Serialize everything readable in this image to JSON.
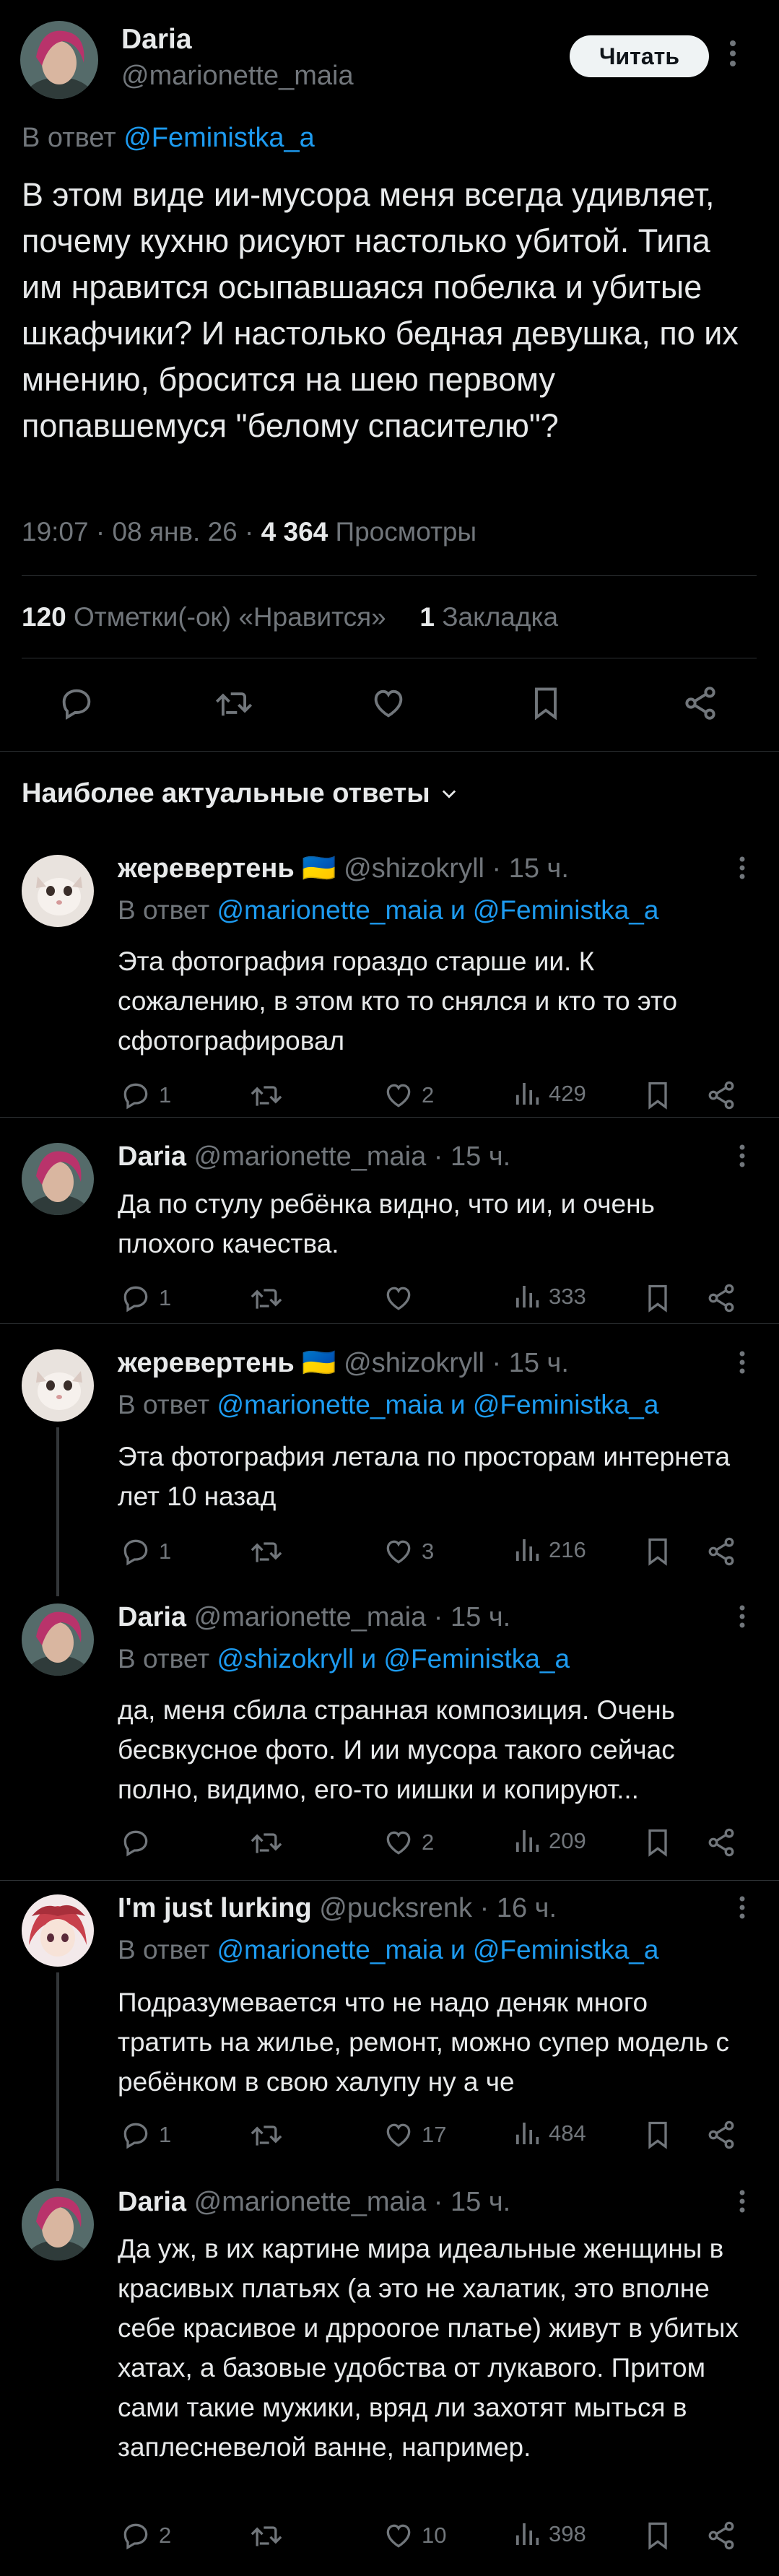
{
  "main": {
    "author_name": "Daria",
    "author_handle": "@marionette_maia",
    "follow_label": "Читать",
    "reply_prefix": "В ответ",
    "reply_to": "@Feministka_a",
    "text": "В этом виде ии-мусора меня всегда удивляет, почему кухню рисуют настолько убитой. Типа им нравится осыпавшаяся побелка и убитые шкафчики? И настолько бедная девушка, по их мнению, бросится на шею первому попавшемуся \"белому спасителю\"?",
    "time": "19:07 · 08 янв. 26 ·",
    "views_count": "4 364",
    "views_label": "Просмотры",
    "likes_count": "120",
    "likes_label": "Отметки(-ок) «Нравится»",
    "bookmarks_count": "1",
    "bookmarks_label": "Закладка"
  },
  "section_title": "Наиболее актуальные ответы",
  "replies": [
    {
      "name": "жеревертень 🇺🇦",
      "handle": "@shizokryll",
      "time": "· 15 ч.",
      "reply_prefix": "В ответ",
      "reply_to": "@marionette_maia и @Feministka_a",
      "text": "Эта фотография гораздо старше ии. К сожалению, в этом кто то снялся и кто то это сфотографировал",
      "replies": "1",
      "retweets": "",
      "likes": "2",
      "views": "429"
    },
    {
      "name": "Daria",
      "handle": "@marionette_maia",
      "time": "· 15 ч.",
      "reply_prefix": "",
      "reply_to": "",
      "text": "Да по стулу ребёнка видно, что ии, и очень плохого качества.",
      "replies": "1",
      "retweets": "",
      "likes": "",
      "views": "333"
    },
    {
      "name": "жеревертень 🇺🇦",
      "handle": "@shizokryll",
      "time": "· 15 ч.",
      "reply_prefix": "В ответ",
      "reply_to": "@marionette_maia и @Feministka_a",
      "text": "Эта фотография летала по просторам интернета лет 10 назад",
      "replies": "1",
      "retweets": "",
      "likes": "3",
      "views": "216"
    },
    {
      "name": "Daria",
      "handle": "@marionette_maia",
      "time": "· 15 ч.",
      "reply_prefix": "В ответ",
      "reply_to": "@shizokryll и @Feministka_a",
      "text": "да, меня сбила странная композиция. Очень бесвкусное фото. И ии мусора такого сейчас полно, видимо, его-то иишки и копируют...",
      "replies": "",
      "retweets": "",
      "likes": "2",
      "views": "209"
    },
    {
      "name": "I'm just lurking",
      "handle": "@pucksrenk",
      "time": "· 16 ч.",
      "reply_prefix": "В ответ",
      "reply_to": "@marionette_maia и @Feministka_a",
      "text": "Подразумевается что не надо деняк много тратить на жилье, ремонт, можно супер модель с ребёнком в свою халупу ну а че",
      "replies": "1",
      "retweets": "",
      "likes": "17",
      "views": "484"
    },
    {
      "name": "Daria",
      "handle": "@marionette_maia",
      "time": "· 15 ч.",
      "reply_prefix": "",
      "reply_to": "",
      "text": "Да уж, в их картине мира идеальные женщины в красивых платьях (а это не халатик, это вполне себе красивое и дрроогое платье) живут в убитых хатах, а базовые удобства от лукавого. Притом сами такие мужики, вряд ли захотят мыться в заплесневелой ванне, например.",
      "replies": "2",
      "retweets": "",
      "likes": "10",
      "views": "398"
    }
  ],
  "icons": [
    "reply-icon",
    "retweet-icon",
    "like-icon",
    "bookmark-icon",
    "share-icon",
    "views-icon",
    "more-icon",
    "chevron-down-icon"
  ],
  "colors": {
    "background": "#000000",
    "text": "#e7e9ea",
    "muted": "#71767b",
    "link": "#1d9bf0",
    "divider": "#2f3336"
  }
}
